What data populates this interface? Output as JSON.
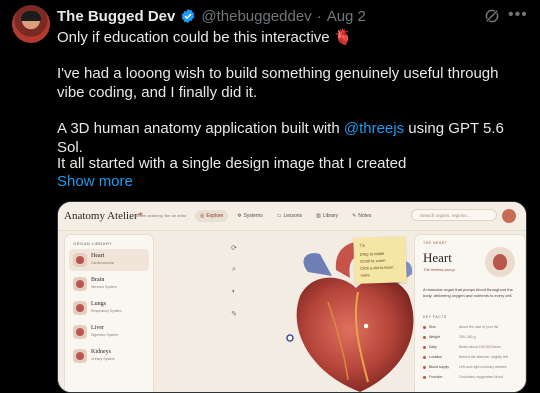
{
  "post": {
    "author_name": "The Bugged Dev",
    "handle": "@thebuggeddev",
    "dot": "·",
    "date": "Aug 2",
    "line1": "Only if education could be this interactive 🫀",
    "para2": "I've had a looong wish to build something genuinely useful through vibe coding, and I finally did it.",
    "para3_prefix": "A 3D human anatomy application built with ",
    "para3_mention": "@threejs",
    "para3_suffix": " using GPT 5.6 Sol.",
    "para4": "It all started with a single design image that I created",
    "show_more": "Show more",
    "icons": {
      "verified": "verified-badge-icon",
      "grok": "grok-icon",
      "more": "more-options-icon"
    },
    "colors": {
      "link": "#1d9bf0",
      "verified": "#1d9bf0",
      "muted": "#71767b",
      "background": "#000000"
    }
  },
  "app": {
    "title": "Anatomy Atelier",
    "title_mark": "*",
    "subtitle": "Learn anatomy, like an artist",
    "nav": [
      "Explore",
      "Systems",
      "Lessons",
      "Library",
      "Notes"
    ],
    "nav_active": "Explore",
    "search_placeholder": "Search organs, regions...",
    "library": {
      "title": "ORGAN LIBRARY",
      "items": [
        {
          "name": "Heart",
          "desc": "Cardiovascular"
        },
        {
          "name": "Brain",
          "desc": "Nervous System"
        },
        {
          "name": "Lungs",
          "desc": "Respiratory System"
        },
        {
          "name": "Liver",
          "desc": "Digestive System"
        },
        {
          "name": "Kidneys",
          "desc": "Urinary System"
        }
      ],
      "selected": "Heart"
    },
    "tools": [
      "Rotate",
      "Zoom",
      "Slice",
      "Annotate"
    ],
    "note": {
      "title": "Tip",
      "lines": [
        "Drag to rotate",
        "Scroll to zoom",
        "Click a dot to learn",
        "more"
      ]
    },
    "panel": {
      "kicker": "THE HEART",
      "heading": "Heart",
      "sub": "The tireless pump",
      "desc": "A muscular organ that pumps blood throughout the body, delivering oxygen and nutrients to every cell.",
      "facts_title": "KEY FACTS",
      "facts": [
        {
          "k": "Size",
          "v": "About the size of your fist"
        },
        {
          "k": "Weight",
          "v": "250–350 g"
        },
        {
          "k": "Daily",
          "v": "Beats about 100,000 times"
        },
        {
          "k": "Location",
          "v": "Behind the sternum, slightly left"
        },
        {
          "k": "Blood supply",
          "v": "Left and right coronary arteries"
        },
        {
          "k": "Function",
          "v": "Circulates oxygenated blood"
        }
      ]
    }
  }
}
